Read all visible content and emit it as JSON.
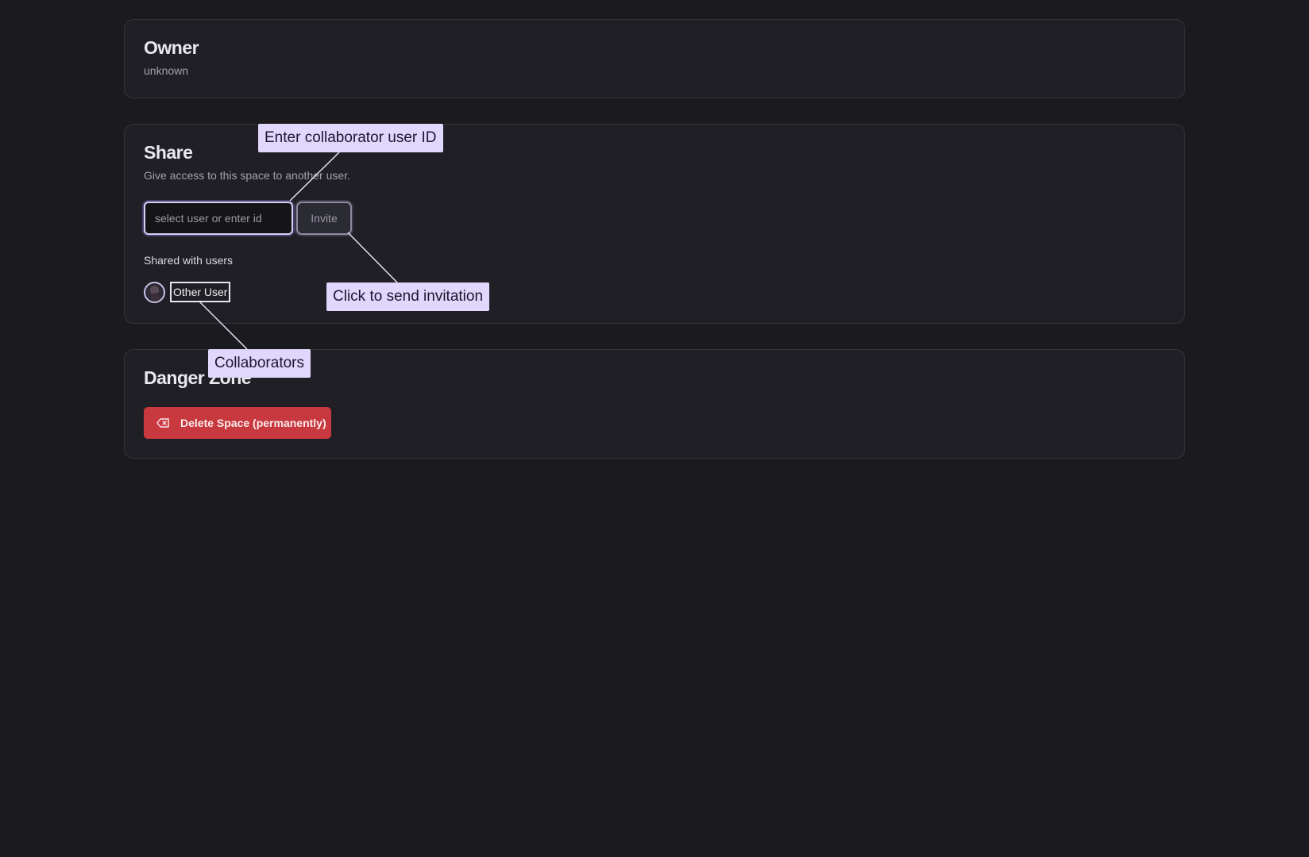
{
  "owner": {
    "title": "Owner",
    "value": "unknown"
  },
  "share": {
    "title": "Share",
    "description": "Give access to this space to another user.",
    "input_placeholder": "select user or enter id",
    "invite_label": "Invite",
    "shared_title": "Shared with users",
    "users": [
      {
        "name": "Other User"
      }
    ]
  },
  "danger": {
    "title": "Danger Zone",
    "delete_label": "Delete Space (permanently)"
  },
  "annotations": {
    "input": "Enter collaborator user ID",
    "invite": "Click to send invitation",
    "users": "Collaborators"
  },
  "colors": {
    "background": "#1a1a1f",
    "card": "#1f1f25",
    "danger": "#c8393f",
    "callout": "#e1d6fb"
  }
}
